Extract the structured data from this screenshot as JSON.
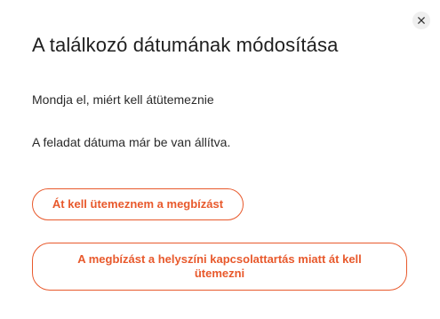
{
  "dialog": {
    "title": "A találkozó dátumának módosítása",
    "close_icon": "close-icon",
    "prompt": "Mondja el, miért kell átütemeznie",
    "info": "A feladat dátuma már be van állítva.",
    "options": [
      {
        "label": "Át kell ütemeznem a megbízást"
      },
      {
        "label": "A megbízást a helyszíni kapcsolattartás miatt át kell ütemezni"
      }
    ]
  },
  "colors": {
    "accent": "#e8592c",
    "text": "#1f1f1f",
    "close_bg": "#efefef"
  }
}
